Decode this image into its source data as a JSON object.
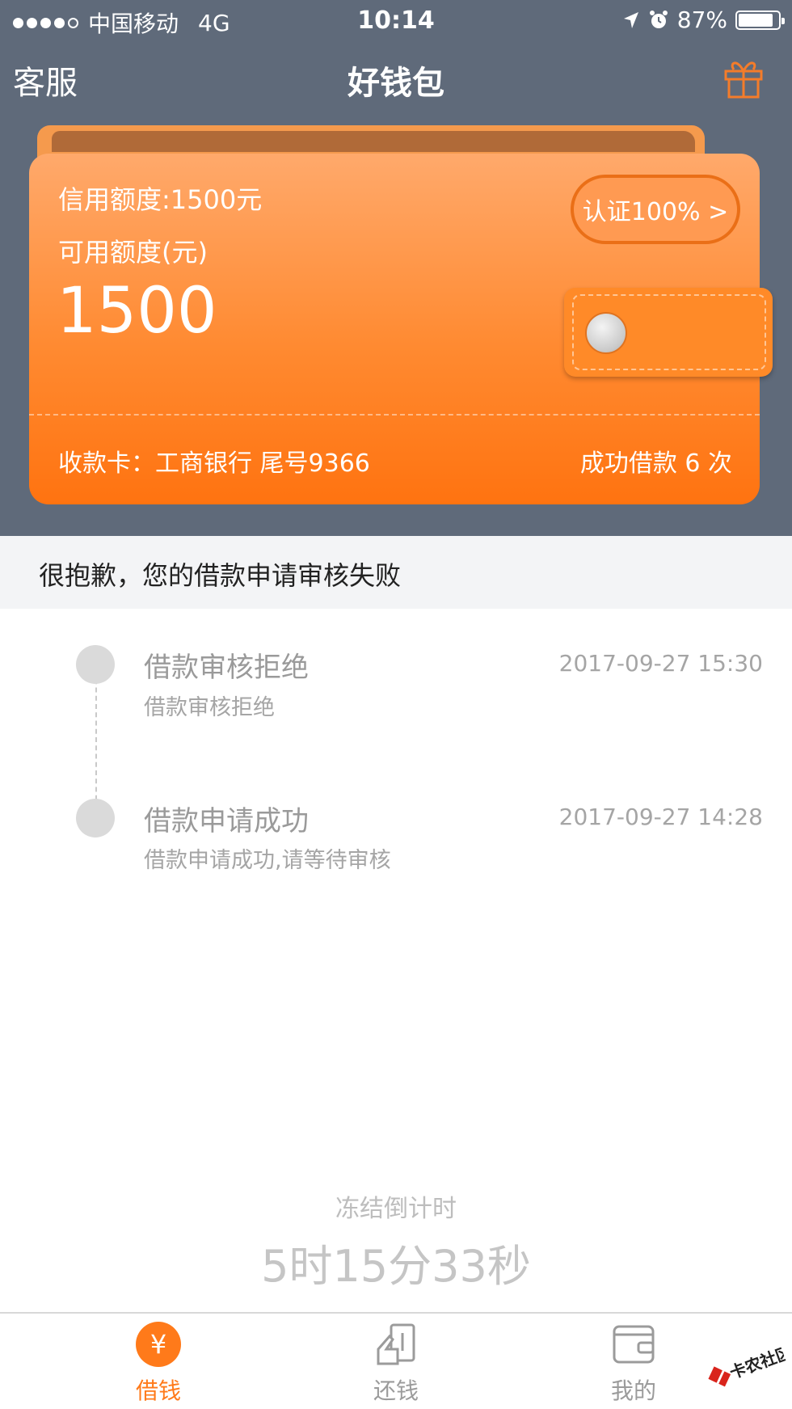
{
  "status_bar": {
    "carrier": "中国移动",
    "network": "4G",
    "time": "10:14",
    "battery": "87%",
    "battery_level": 0.87
  },
  "nav": {
    "left_label": "客服",
    "title": "好钱包",
    "right_icon": "gift-icon"
  },
  "wallet": {
    "credit_limit": "信用额度:1500元",
    "available_label": "可用额度(元)",
    "available_amount": "1500",
    "cert_button": "认证100% >",
    "bank_card": "收款卡：工商银行 尾号9366",
    "success_count": "成功借款 6 次"
  },
  "notice": {
    "text": "很抱歉，您的借款申请审核失败"
  },
  "timeline": [
    {
      "title": "借款审核拒绝",
      "subtitle": "借款审核拒绝",
      "time": "2017-09-27 15:30"
    },
    {
      "title": "借款申请成功",
      "subtitle": "借款申请成功,请等待审核",
      "time": "2017-09-27 14:28"
    }
  ],
  "countdown": {
    "label": "冻结倒计时",
    "value": "5时15分33秒"
  },
  "tabbar": {
    "items": [
      {
        "label": "借钱",
        "icon": "yen-icon",
        "active": true
      },
      {
        "label": "还钱",
        "icon": "repay-icon",
        "active": false
      },
      {
        "label": "我的",
        "icon": "wallet-icon",
        "active": false
      }
    ]
  },
  "watermark": {
    "text": "卡农社区"
  },
  "colors": {
    "accent": "#ff7a1a",
    "header_bg": "#5f6a7a",
    "card_top": "#ffa96b",
    "card_bottom": "#ff7310"
  }
}
